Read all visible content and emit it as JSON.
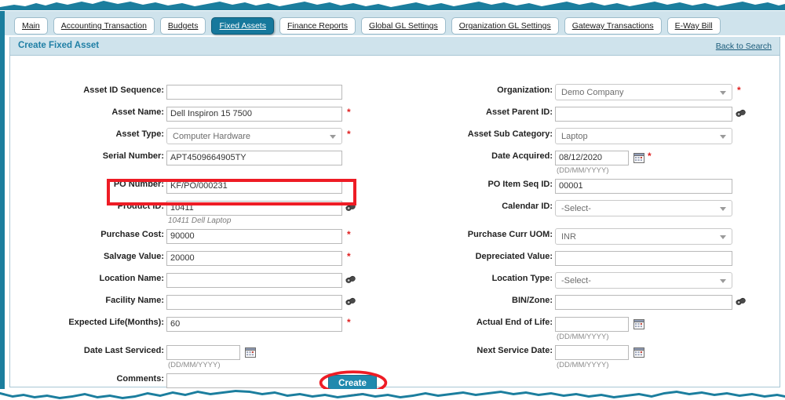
{
  "tabs": [
    {
      "label": "Main",
      "active": false
    },
    {
      "label": "Accounting Transaction",
      "active": false
    },
    {
      "label": "Budgets",
      "active": false
    },
    {
      "label": "Fixed Assets",
      "active": true
    },
    {
      "label": "Finance Reports",
      "active": false
    },
    {
      "label": "Global GL Settings",
      "active": false
    },
    {
      "label": "Organization GL Settings",
      "active": false
    },
    {
      "label": "Gateway Transactions",
      "active": false
    },
    {
      "label": "E-Way Bill",
      "active": false
    }
  ],
  "panel": {
    "title": "Create Fixed Asset",
    "back_link": "Back to Search"
  },
  "left_fields": [
    {
      "label": "Asset ID Sequence:",
      "value": "",
      "type": "text",
      "required": false,
      "icon": "",
      "hint": ""
    },
    {
      "label": "Asset Name:",
      "value": "Dell Inspiron 15 7500",
      "type": "text",
      "required": true,
      "icon": "",
      "hint": ""
    },
    {
      "label": "Asset Type:",
      "value": "Computer Hardware",
      "type": "select",
      "required": true,
      "icon": "",
      "hint": ""
    },
    {
      "label": "Serial Number:",
      "value": "APT4509664905TY",
      "type": "text",
      "required": false,
      "icon": "",
      "hint": ""
    },
    {
      "label": "PO Number:",
      "value": "KF/PO/000231",
      "type": "text",
      "required": false,
      "icon": "",
      "hint": ""
    },
    {
      "label": "Product ID:",
      "value": "10411",
      "type": "text",
      "required": false,
      "icon": "lookup-icon",
      "hint": "10411 Dell Laptop"
    },
    {
      "label": "Purchase Cost:",
      "value": "90000",
      "type": "text",
      "required": true,
      "icon": "",
      "hint": ""
    },
    {
      "label": "Salvage Value:",
      "value": "20000",
      "type": "text",
      "required": true,
      "icon": "",
      "hint": ""
    },
    {
      "label": "Location Name:",
      "value": "",
      "type": "text",
      "required": false,
      "icon": "lookup-icon",
      "hint": ""
    },
    {
      "label": "Facility Name:",
      "value": "",
      "type": "text",
      "required": false,
      "icon": "lookup-icon",
      "hint": ""
    },
    {
      "label": "Expected Life(Months):",
      "value": "60",
      "type": "text",
      "required": true,
      "icon": "",
      "hint": ""
    },
    {
      "label": "Date Last Serviced:",
      "value": "",
      "type": "date",
      "required": false,
      "icon": "calendar-icon",
      "hint": "(DD/MM/YYYY)"
    },
    {
      "label": "Comments:",
      "value": "",
      "type": "text",
      "required": false,
      "icon": "",
      "hint": ""
    }
  ],
  "right_fields": [
    {
      "label": "Organization:",
      "value": "Demo Company",
      "type": "select",
      "required": true,
      "icon": "",
      "hint": ""
    },
    {
      "label": "Asset Parent ID:",
      "value": "",
      "type": "text",
      "required": false,
      "icon": "lookup-icon",
      "hint": ""
    },
    {
      "label": "Asset Sub Category:",
      "value": "Laptop",
      "type": "select",
      "required": false,
      "icon": "",
      "hint": ""
    },
    {
      "label": "Date Acquired:",
      "value": "08/12/2020",
      "type": "date",
      "required": true,
      "icon": "calendar-icon",
      "hint": "(DD/MM/YYYY)"
    },
    {
      "label": "PO Item Seq ID:",
      "value": "00001",
      "type": "text",
      "required": false,
      "icon": "",
      "hint": ""
    },
    {
      "label": "Calendar ID:",
      "value": "-Select-",
      "type": "select",
      "required": false,
      "icon": "",
      "hint": ""
    },
    {
      "label": "Purchase Curr UOM:",
      "value": "INR",
      "type": "select",
      "required": false,
      "icon": "",
      "hint": ""
    },
    {
      "label": "Depreciated Value:",
      "value": "",
      "type": "text",
      "required": false,
      "icon": "",
      "hint": ""
    },
    {
      "label": "Location Type:",
      "value": "-Select-",
      "type": "select",
      "required": false,
      "icon": "",
      "hint": ""
    },
    {
      "label": "BIN/Zone:",
      "value": "",
      "type": "text",
      "required": false,
      "icon": "lookup-icon",
      "hint": ""
    },
    {
      "label": "Actual End of Life:",
      "value": "",
      "type": "date",
      "required": false,
      "icon": "calendar-icon",
      "hint": "(DD/MM/YYYY)"
    },
    {
      "label": "Next Service Date:",
      "value": "",
      "type": "date",
      "required": false,
      "icon": "calendar-icon",
      "hint": "(DD/MM/YYYY)"
    }
  ],
  "actions": {
    "create_label": "Create"
  },
  "colors": {
    "teal": "#1b7e9e",
    "tab_active": "#16789c",
    "header_bg": "#cfe3ec",
    "annotation_red": "#ee1c25",
    "button_bg": "#2089ae",
    "required_red": "#e02020"
  }
}
